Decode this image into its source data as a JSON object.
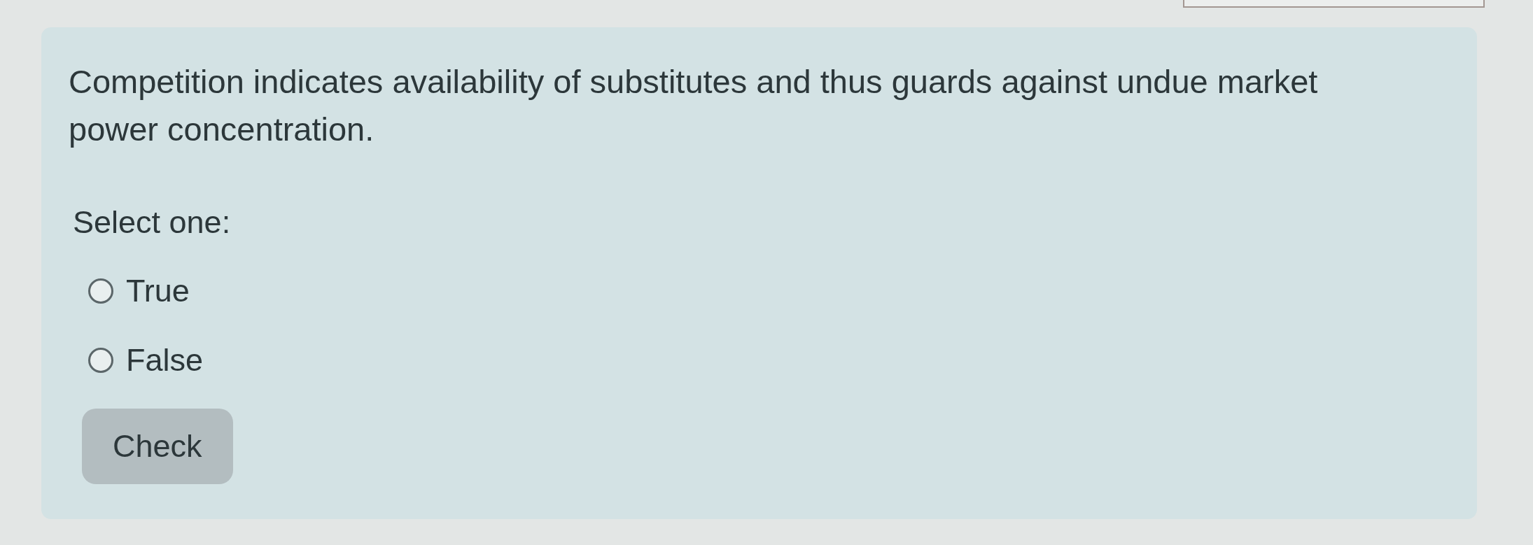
{
  "question": {
    "text": "Competition indicates availability of substitutes and thus guards against undue market power concentration.",
    "prompt": "Select one:",
    "options": [
      {
        "label": "True",
        "selected": false
      },
      {
        "label": "False",
        "selected": false
      }
    ],
    "check_button": "Check"
  }
}
